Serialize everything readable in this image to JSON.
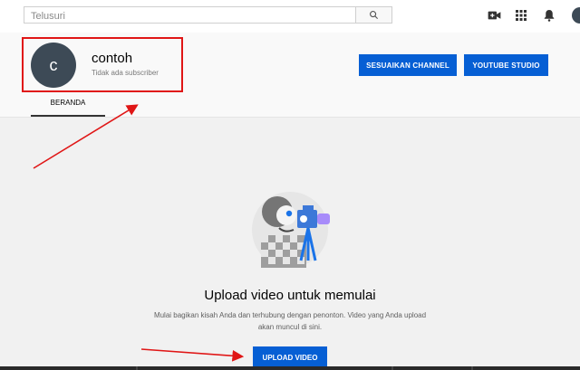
{
  "search": {
    "placeholder": "Telusuri",
    "value": ""
  },
  "top_icons": [
    "search-icon",
    "video-camera-plus-icon",
    "apps-grid-icon",
    "bell-icon"
  ],
  "channel": {
    "avatar_letter": "c",
    "name": "contoh",
    "subscribers": "Tidak ada subscriber"
  },
  "buttons": {
    "customize": "SESUAIKAN CHANNEL",
    "studio": "YOUTUBE STUDIO",
    "upload": "UPLOAD VIDEO"
  },
  "tabs": [
    {
      "label": "BERANDA",
      "active": true
    }
  ],
  "empty_state": {
    "title": "Upload video untuk memulai",
    "description": "Mulai bagikan kisah Anda dan terhubung dengan penonton. Video yang Anda upload akan muncul di sini."
  },
  "colors": {
    "accent_blue": "#065fd4",
    "annotation_red": "#e01616",
    "avatar": "#3d4a56"
  }
}
